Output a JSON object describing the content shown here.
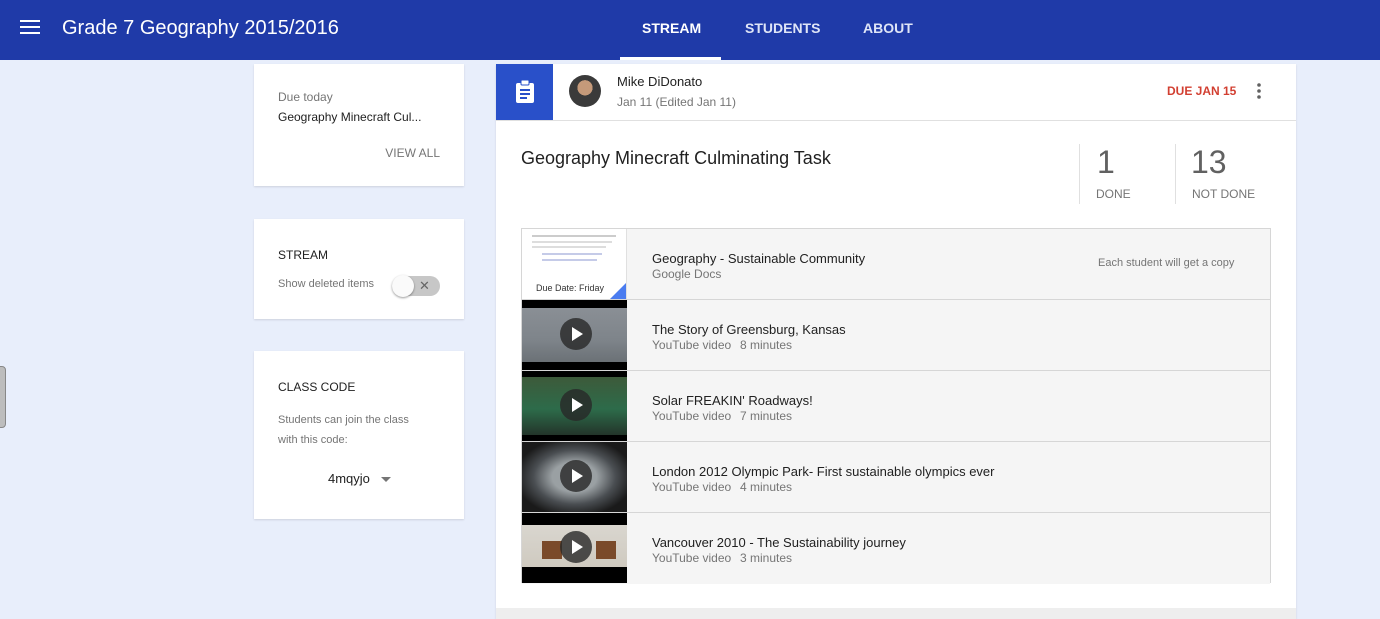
{
  "header": {
    "class_title": "Grade 7 Geography 2015/2016",
    "tabs": [
      {
        "label": "STREAM",
        "active": true
      },
      {
        "label": "STUDENTS",
        "active": false
      },
      {
        "label": "ABOUT",
        "active": false
      }
    ],
    "background_color": "#1f3aa8"
  },
  "sidebar": {
    "due_card": {
      "label": "Due today",
      "item": "Geography Minecraft Cul...",
      "view_all": "VIEW ALL"
    },
    "stream_card": {
      "title": "STREAM",
      "toggle_label": "Show deleted items",
      "toggle_on": false
    },
    "class_code_card": {
      "title": "CLASS CODE",
      "description_line1": "Students can join the class",
      "description_line2": "with this code:",
      "code": "4mqyjo"
    }
  },
  "assignment": {
    "author": "Mike DiDonato",
    "date": "Jan 11 (Edited Jan 11)",
    "due": "DUE JAN 15",
    "due_color": "#d23f31",
    "title": "Geography Minecraft Culminating Task",
    "done_count": "1",
    "done_label": "DONE",
    "not_done_count": "13",
    "not_done_label": "NOT DONE",
    "attachments": [
      {
        "title": "Geography - Sustainable Community",
        "type": "Google Docs",
        "duration": "",
        "note": "Each student will get a copy",
        "thumb_text": "Due Date:  Friday"
      },
      {
        "title": "The Story of Greensburg, Kansas",
        "type": "YouTube video",
        "duration": "8 minutes",
        "note": ""
      },
      {
        "title": "Solar FREAKIN' Roadways!",
        "type": "YouTube video",
        "duration": "7 minutes",
        "note": ""
      },
      {
        "title": "London 2012 Olympic Park- First sustainable olympics ever",
        "type": "YouTube video",
        "duration": "4 minutes",
        "note": ""
      },
      {
        "title": "Vancouver 2010 - The Sustainability journey",
        "type": "YouTube video",
        "duration": "3 minutes",
        "note": ""
      }
    ]
  }
}
